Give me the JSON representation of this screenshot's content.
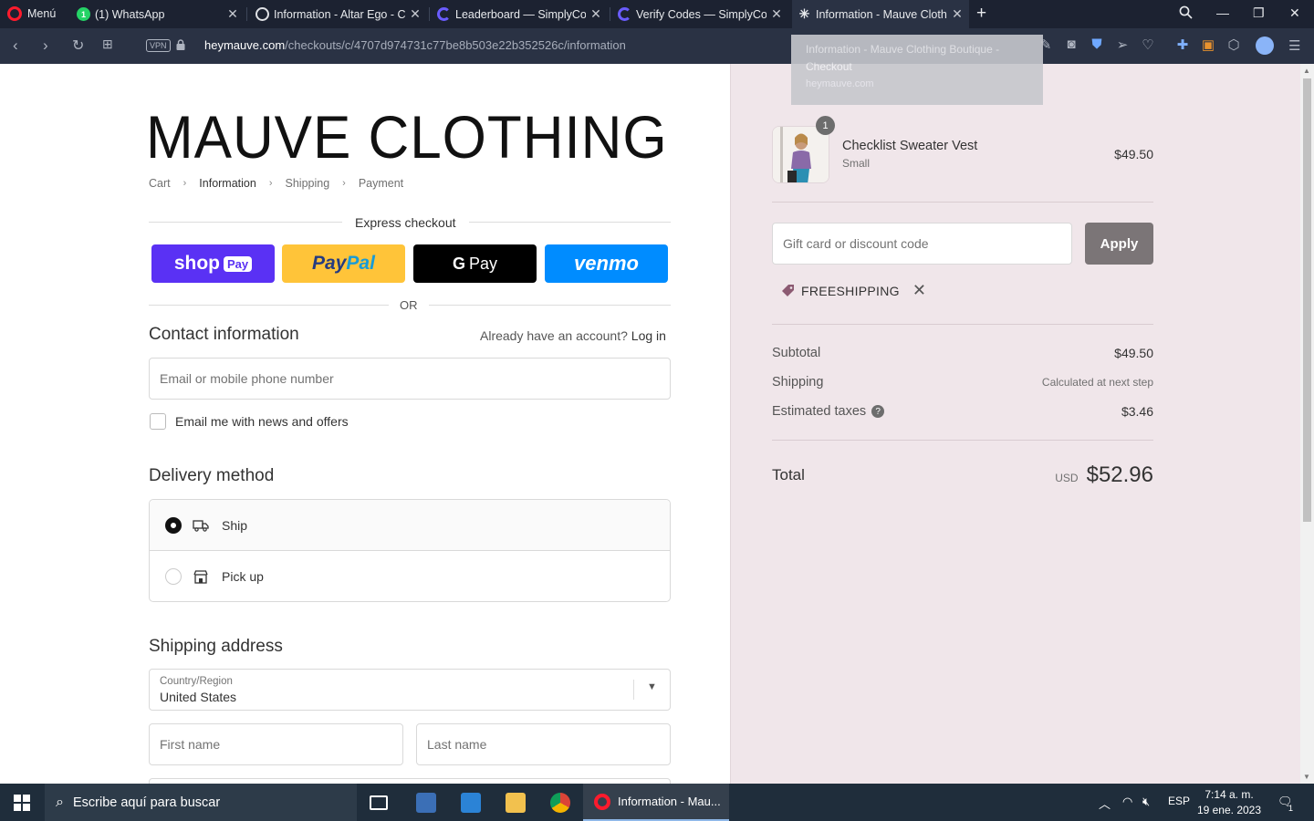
{
  "browser": {
    "menu_label": "Menú",
    "tabs": [
      {
        "title": "(1) WhatsApp",
        "badge": "1"
      },
      {
        "title": "Information - Altar Ego - Ch"
      },
      {
        "title": "Leaderboard — SimplyCod"
      },
      {
        "title": "Verify Codes — SimplyCod"
      },
      {
        "title": "Information - Mauve Clothi"
      }
    ],
    "vpn_label": "VPN",
    "url_host": "heymauve.com",
    "url_path": "/checkouts/c/4707d974731c77be8b503e22b352526c/information",
    "tooltip_title": "Information - Mauve Clothing Boutique - Checkout",
    "tooltip_url": "heymauve.com"
  },
  "checkout": {
    "logo": "MAUVE CLOTHING",
    "breadcrumb": [
      "Cart",
      "Information",
      "Shipping",
      "Payment"
    ],
    "express_label": "Express checkout",
    "pay_buttons": {
      "shop": "shop",
      "shop_chip": "Pay",
      "paypal_a": "Pay",
      "paypal_b": "Pal",
      "gpay_g": "G",
      "gpay": "Pay",
      "venmo": "venmo"
    },
    "or_label": "OR",
    "contact_title": "Contact information",
    "have_account": "Already have an account?",
    "login": "Log in",
    "email_placeholder": "Email or mobile phone number",
    "newsletter_label": "Email me with news and offers",
    "delivery_title": "Delivery method",
    "delivery_options": [
      "Ship",
      "Pick up"
    ],
    "shipping_title": "Shipping address",
    "country_caption": "Country/Region",
    "country_value": "United States",
    "first_name_placeholder": "First name",
    "last_name_placeholder": "Last name"
  },
  "summary": {
    "qty": "1",
    "product_name": "Checklist Sweater Vest",
    "product_variant": "Small",
    "product_price": "$49.50",
    "discount_placeholder": "Gift card or discount code",
    "apply_label": "Apply",
    "applied_code": "FREESHIPPING",
    "subtotal_label": "Subtotal",
    "subtotal_value": "$49.50",
    "shipping_label": "Shipping",
    "shipping_value": "Calculated at next step",
    "taxes_label": "Estimated taxes",
    "taxes_value": "$3.46",
    "total_label": "Total",
    "currency": "USD",
    "total_value": "$52.96"
  },
  "taskbar": {
    "search_placeholder": "Escribe aquí para buscar",
    "opera_task": "Information - Mau...",
    "lang": "ESP",
    "time": "7:14 a. m.",
    "date": "19 ene. 2023",
    "notif_count": "1"
  },
  "colors": {
    "tabbar_bg": "#1c2231",
    "summary_bg": "#f0e6ea",
    "shop_pay": "#5a31f4",
    "paypal": "#ffc439",
    "venmo": "#008cff",
    "apply_button": "#7b7577"
  }
}
